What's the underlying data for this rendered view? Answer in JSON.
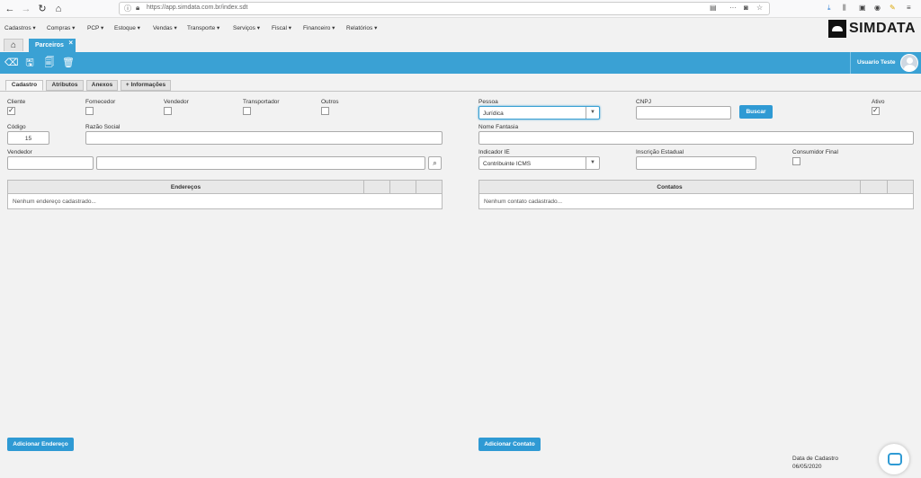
{
  "browser": {
    "url": "https://app.simdata.com.br/index.sdt"
  },
  "menu": {
    "items": [
      "Cadastros ▾",
      "Compras ▾",
      "PCP ▾",
      "Estoque ▾",
      "Vendas ▾",
      "Transporte ▾",
      "Serviços ▾",
      "Fiscal ▾",
      "Financeiro ▾",
      "Relatórios ▾"
    ],
    "logo_text": "SIMDATA"
  },
  "page_tab": {
    "label": "Parceiros",
    "close": "×"
  },
  "user": {
    "name": "Usuario Teste"
  },
  "subtabs": [
    "Cadastro",
    "Atributos",
    "Anexos",
    "+ Informações"
  ],
  "form": {
    "cliente_label": "Cliente",
    "fornecedor_label": "Fornecedor",
    "vendedor_chk_label": "Vendedor",
    "transportador_label": "Transportador",
    "outros_label": "Outros",
    "codigo_label": "Código",
    "codigo_value": "15",
    "razao_label": "Razão Social",
    "razao_value": "",
    "vendedor_label": "Vendedor",
    "vendedor_code": "",
    "vendedor_name": "",
    "pessoa_label": "Pessoa",
    "pessoa_value": "Jurídica",
    "cnpj_label": "CNPJ",
    "cnpj_value": "",
    "buscar_label": "Buscar",
    "ativo_label": "Ativo",
    "fantasia_label": "Nome Fantasia",
    "fantasia_value": "",
    "indicador_label": "Indicador IE",
    "indicador_value": "Contribuinte ICMS",
    "inscricao_label": "Inscrição Estadual",
    "inscricao_value": "",
    "consumidor_label": "Consumidor Final"
  },
  "enderecos": {
    "title": "Endereços",
    "empty": "Nenhum endereço cadastrado...",
    "add_button": "Adicionar Endereço"
  },
  "contatos": {
    "title": "Contatos",
    "empty": "Nenhum contato cadastrado...",
    "add_button": "Adicionar Contato"
  },
  "footer": {
    "data_label": "Data de Cadastro",
    "data_value": "06/05/2020"
  }
}
